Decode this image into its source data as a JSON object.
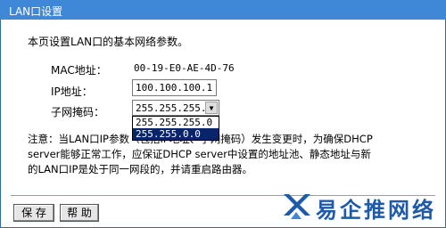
{
  "window": {
    "title": "LAN口设置"
  },
  "intro": "本页设置LAN口的基本网络参数。",
  "mac": {
    "label": "MAC地址：",
    "value": "00-19-E0-AE-4D-76"
  },
  "ip": {
    "label": "IP地址：",
    "value": "100.100.100.1"
  },
  "subnet": {
    "label": "子网掩码：",
    "value": "255.255.255.0",
    "options": [
      "255.255.255.0",
      "255.255.0.0"
    ],
    "highlighted_option": "255.255.0.0"
  },
  "note": {
    "line1": "注意：当LAN口IP参数（包括IP地址、子网掩码）发生变更时，为确保DHCP",
    "line2": "server能够正常工作，应保证DHCP server中设置的地址池、静态地址与新",
    "line3": "的LAN口IP是处于同一网段的，并请重启路由器。"
  },
  "buttons": {
    "save": "保 存",
    "help": "帮 助"
  },
  "watermark": {
    "text": "易企推网络"
  },
  "colors": {
    "titlebar": "#3f88d8",
    "logo": "#1f5aa8",
    "selection": "#0a246a"
  }
}
